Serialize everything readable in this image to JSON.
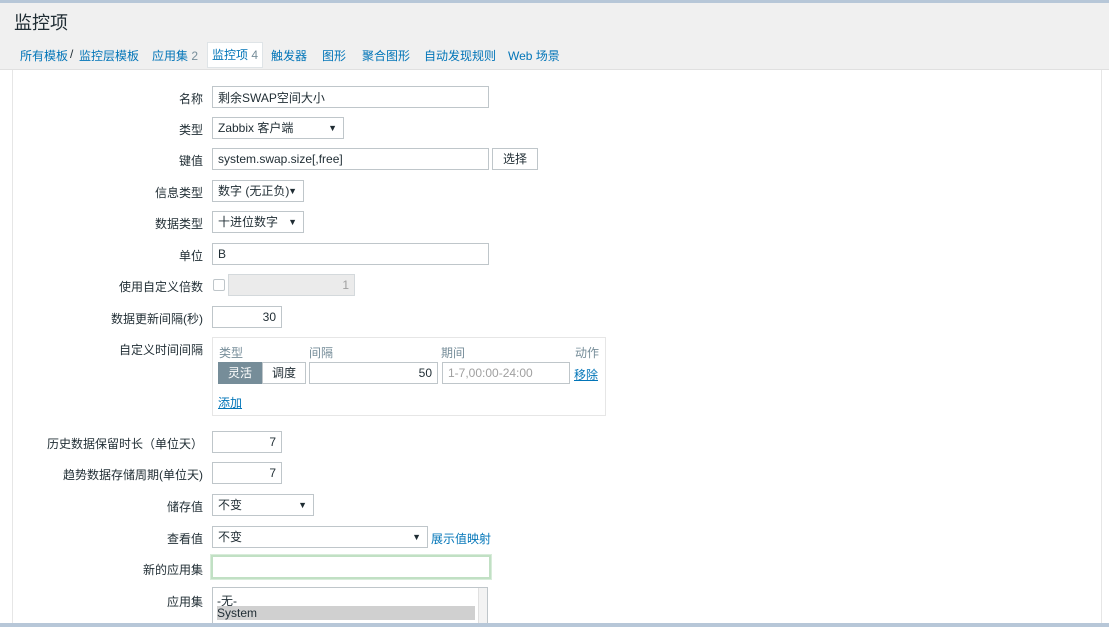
{
  "page": {
    "title": "监控项"
  },
  "nav": {
    "all_templates": "所有模板",
    "sep": "/",
    "template_name": "监控层模板",
    "applications": "应用集",
    "applications_count": "2",
    "items": "监控项",
    "items_count": "4",
    "triggers": "触发器",
    "graphs": "图形",
    "screens": "聚合图形",
    "discovery": "自动发现规则",
    "web": "Web 场景"
  },
  "form": {
    "name": {
      "label": "名称",
      "value": "剩余SWAP空间大小"
    },
    "type": {
      "label": "类型",
      "value": "Zabbix 客户端"
    },
    "key": {
      "label": "键值",
      "value": "system.swap.size[,free]",
      "button": "选择"
    },
    "info_type": {
      "label": "信息类型",
      "value": "数字 (无正负)"
    },
    "data_type": {
      "label": "数据类型",
      "value": "十进位数字"
    },
    "units": {
      "label": "单位",
      "value": "B"
    },
    "multiplier": {
      "label": "使用自定义倍数",
      "value": "1",
      "checked": false
    },
    "update_interval": {
      "label": "数据更新间隔(秒)",
      "value": "30"
    },
    "custom_intervals": {
      "label": "自定义时间间隔",
      "col_type": "类型",
      "col_interval": "间隔",
      "col_period": "期间",
      "col_action": "动作",
      "flexible": "灵活",
      "scheduling": "调度",
      "interval_value": "50",
      "period_value": "1-7,00:00-24:00",
      "remove": "移除",
      "add": "添加"
    },
    "history": {
      "label": "历史数据保留时长（单位天）",
      "value": "7"
    },
    "trends": {
      "label": "趋势数据存储周期(单位天)",
      "value": "7"
    },
    "store_value": {
      "label": "储存值",
      "value": "不变"
    },
    "show_value": {
      "label": "查看值",
      "value": "不变",
      "link": "展示值映射"
    },
    "new_application": {
      "label": "新的应用集",
      "value": ""
    },
    "applications": {
      "label": "应用集",
      "options": [
        "-无-",
        "System"
      ],
      "selected": "System"
    }
  },
  "colors": {
    "link": "#0275b8",
    "accent_grey": "#768d99",
    "header_bg": "#f0f0f0"
  },
  "icons": {
    "dropdown": "dropdown-arrow-icon"
  }
}
